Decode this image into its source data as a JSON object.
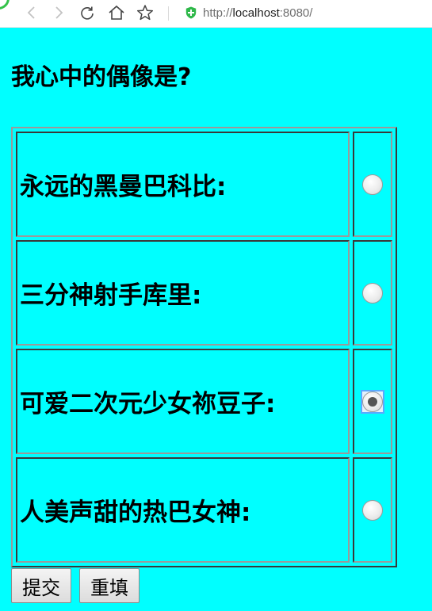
{
  "browser": {
    "url_scheme": "http://",
    "url_host": "localhost",
    "url_port": ":8080/",
    "icons": [
      "back-icon",
      "forward-icon",
      "reload-icon",
      "home-icon",
      "star-icon",
      "shield-icon"
    ]
  },
  "page": {
    "background": "#00ffff",
    "heading": "我心中的偶像是?",
    "options": [
      {
        "label": "永远的黑曼巴科比:",
        "selected": false
      },
      {
        "label": "三分神射手库里:",
        "selected": false
      },
      {
        "label": "可爱二次元少女祢豆子:",
        "selected": true
      },
      {
        "label": "人美声甜的热巴女神:",
        "selected": false
      }
    ],
    "buttons": {
      "submit": "提交",
      "reset": "重填"
    }
  }
}
